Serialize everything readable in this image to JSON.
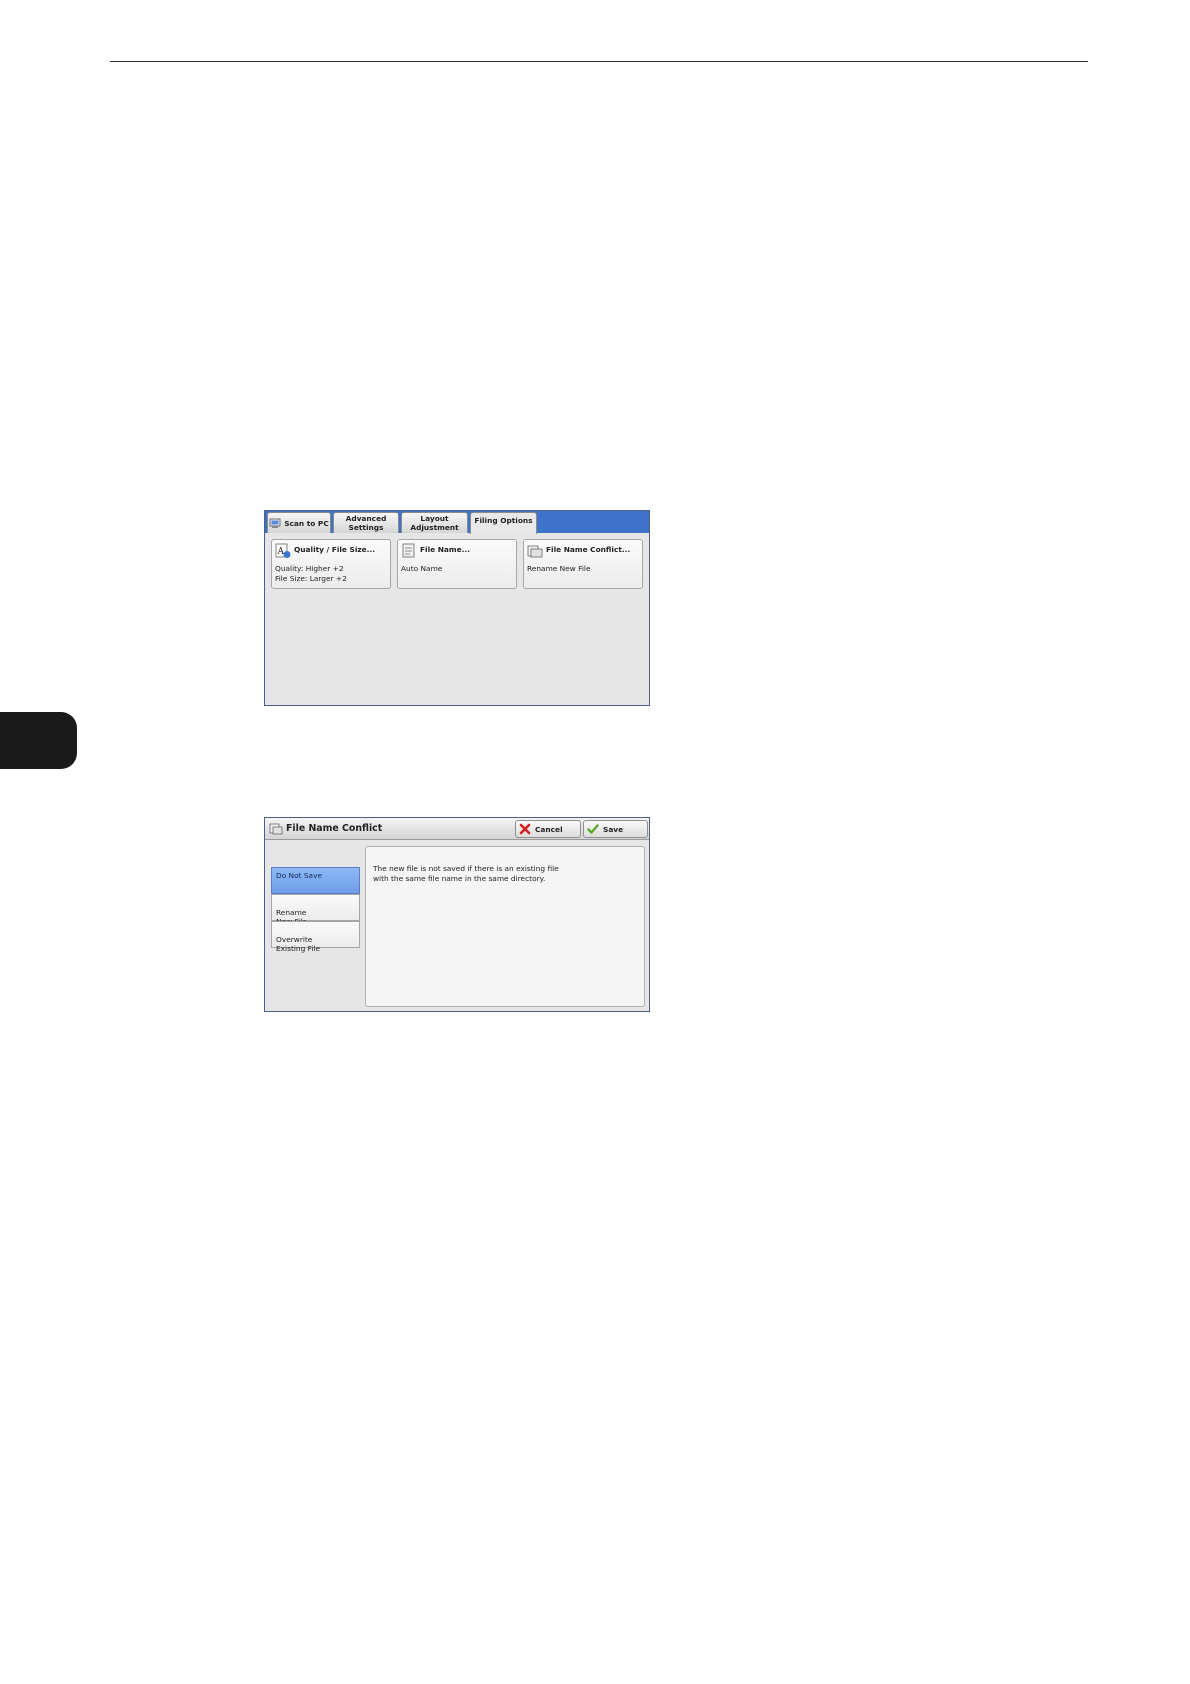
{
  "screen1": {
    "tabs": [
      {
        "label": "Scan to PC"
      },
      {
        "label": "Advanced\nSettings"
      },
      {
        "label": "Layout\nAdjustment"
      },
      {
        "label": "Filing Options"
      }
    ],
    "active_tab": "Filing Options",
    "buttons": [
      {
        "title": "Quality / File Size...",
        "line1": "Quality: Higher +2",
        "line2": "File Size: Larger +2"
      },
      {
        "title": "File Name...",
        "line1": "Auto Name"
      },
      {
        "title": "File Name Conflict...",
        "line1": "Rename New File"
      }
    ]
  },
  "screen2": {
    "title": "File Name Conflict",
    "cancel_label": "Cancel",
    "save_label": "Save",
    "options": [
      {
        "label": "Do Not Save"
      },
      {
        "label": "Rename\nNew File"
      },
      {
        "label": "Overwrite\nExisting File"
      }
    ],
    "selected_option": "Do Not Save",
    "description": "The new file is not saved if there is an existing file\nwith the same file name in the same directory."
  },
  "colors": {
    "tab_bar_blue": "#3d73c9",
    "selected_blue": "#7aa8ee",
    "chapter_tab": "#1a1a1a"
  }
}
